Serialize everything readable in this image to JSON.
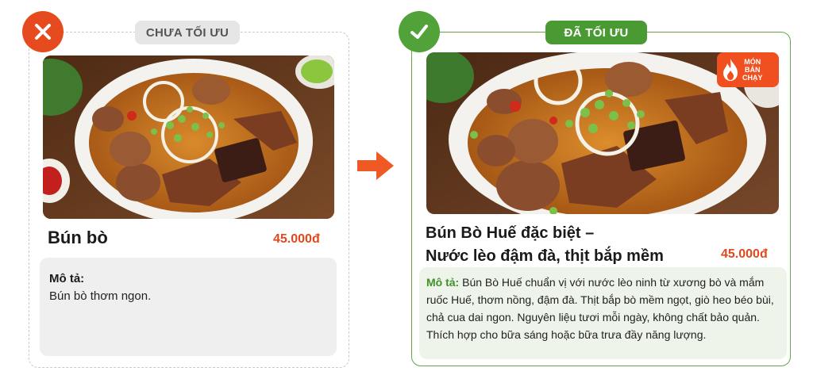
{
  "before": {
    "tag": "CHƯA TỐI ƯU",
    "icon": "close-icon",
    "name": "Bún bò",
    "price": "45.000đ",
    "desc_label": "Mô tả:",
    "desc_text": "Bún bò thơm ngon."
  },
  "after": {
    "tag": "ĐÃ TỐI ƯU",
    "icon": "check-icon",
    "name_line1": "Bún Bò Huế đặc biệt –",
    "name_line2": "Nước lèo đậm đà, thịt bắp mềm",
    "price": "45.000đ",
    "badge_line1": "MÓN",
    "badge_line2": "BÁN",
    "badge_line3": "CHẠY",
    "desc_label": "Mô tả:",
    "desc_text": "Bún Bò Huế chuẩn vị với nước lèo ninh từ xương bò và mắm ruốc Huế, thơm nồng, đậm đà. Thịt bắp bò mềm ngọt, giò heo béo bùi, chả cua dai ngon. Nguyên liệu tươi mỗi ngày, không chất bảo quản. Thích hợp cho bữa sáng hoặc bữa trưa đầy năng lượng."
  },
  "colors": {
    "accent_bad": "#e54b1f",
    "accent_good": "#52a23a",
    "price": "#e2481e"
  }
}
